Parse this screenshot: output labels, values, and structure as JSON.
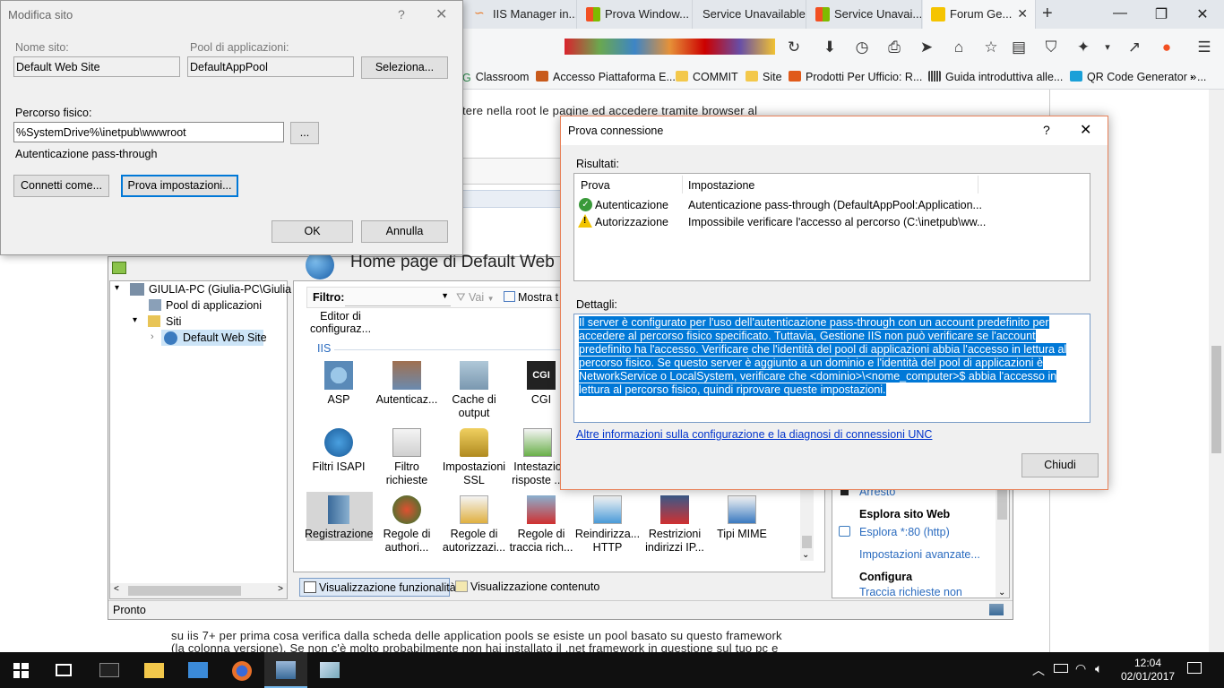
{
  "browser": {
    "tabs": [
      {
        "label": "IIS Manager in...",
        "color": "#e87722"
      },
      {
        "label": "Prova Window...",
        "color": "#f25022"
      },
      {
        "label": "Service Unavailable",
        "color": "#ffffff"
      },
      {
        "label": "Service Unavai...",
        "color": "#f25022"
      },
      {
        "label": "Forum Ge...",
        "color": "#f5c400"
      }
    ],
    "bookmarks": [
      {
        "label": "Classroom",
        "color": "#2c8c4c"
      },
      {
        "label": "Accesso Piattaforma E...",
        "color": "#c85a1c"
      },
      {
        "label": "COMMIT",
        "color": "#f3c84b"
      },
      {
        "label": "Site",
        "color": "#f3c84b"
      },
      {
        "label": "Prodotti Per Ufficio: R...",
        "color": "#e05a1a"
      },
      {
        "label": "Guida introduttiva alle...",
        "color": "#444444"
      },
      {
        "label": "QR Code Generator - ...",
        "color": "#1aa0d8"
      }
    ],
    "page_text_top": "tere nella root le pagine ed accedere tramite browser al",
    "page_text_bottom_1": "su iis 7+ per prima cosa verifica dalla scheda delle application pools se esiste un pool basato su questo framework",
    "page_text_bottom_2": "(la colonna versione). Se non c'è molto probabilmente non hai installato il .net framework in questione sul tuo pc e"
  },
  "iis": {
    "home_title": "Home page di Default Web S",
    "filter_label": "Filtro:",
    "go_label": "Vai",
    "show_all_label": "Mostra t",
    "partial_item": "Editor di configuraz...",
    "group_label": "IIS",
    "tree": {
      "server": "GIULIA-PC (Giulia-PC\\Giulia S",
      "pools": "Pool di applicazioni",
      "sites": "Siti",
      "default_site": "Default Web Site"
    },
    "features_row1": [
      "ASP",
      "Autenticaz...",
      "Cache di output",
      "CGI",
      "Filtri ISAPI",
      "Filtro richieste",
      "Impostazioni SSL",
      "Intestazio risposte ..."
    ],
    "features_row2": [
      "Registrazione",
      "Regole di authori...",
      "Regole di autorizzazi...",
      "Regole di traccia rich...",
      "Reindirizza... HTTP",
      "Restrizioni indirizzi IP...",
      "Tipi MIME"
    ],
    "view_features": "Visualizzazione funzionalità",
    "view_content": "Visualizzazione contenuto",
    "status": "Pronto",
    "actions": {
      "stop": "Arresto",
      "browse_header": "Esplora sito Web",
      "browse_link": "Esplora *:80 (http)",
      "advanced": "Impostazioni avanzate...",
      "configure_header": "Configura",
      "trace": "Traccia richieste non"
    }
  },
  "dialog_edit_site": {
    "title": "Modifica sito",
    "help": "?",
    "site_name_label": "Nome sito:",
    "site_name_value": "Default Web Site",
    "app_pool_label": "Pool di applicazioni:",
    "app_pool_value": "DefaultAppPool",
    "select_button": "Seleziona...",
    "physical_path_label": "Percorso fisico:",
    "physical_path_value": "%SystemDrive%\\inetpub\\wwwroot",
    "browse_button": "...",
    "pass_through_label": "Autenticazione pass-through",
    "connect_as_button": "Connetti come...",
    "test_settings_button": "Prova impostazioni...",
    "ok_button": "OK",
    "cancel_button": "Annulla"
  },
  "dialog_test": {
    "title": "Prova connessione",
    "help": "?",
    "results_label": "Risultati:",
    "col_test": "Prova",
    "col_setting": "Impostazione",
    "rows": [
      {
        "test": "Autenticazione",
        "setting": "Autenticazione pass-through (DefaultAppPool:Application...",
        "status": "ok"
      },
      {
        "test": "Autorizzazione",
        "setting": "Impossibile verificare l'accesso al percorso (C:\\inetpub\\ww...",
        "status": "warning"
      }
    ],
    "details_label": "Dettagli:",
    "details_text": "Il server è configurato per l'uso dell'autenticazione pass-through con un account predefinito per accedere al percorso fisico specificato. Tuttavia, Gestione IIS non può verificare se l'account predefinito ha l'accesso. Verificare che l'identità del pool di applicazioni abbia l'accesso in lettura al percorso fisico. Se questo server è aggiunto a un dominio e l'identità del pool di applicazioni è NetworkService o LocalSystem, verificare che <dominio>\\<nome_computer>$ abbia l'accesso in lettura al percorso fisico, quindi riprovare queste impostazioni.",
    "link": "Altre informazioni sulla configurazione e la diagnosi di connessioni UNC",
    "close_button": "Chiudi"
  },
  "taskbar": {
    "time": "12:04",
    "date": "02/01/2017"
  }
}
